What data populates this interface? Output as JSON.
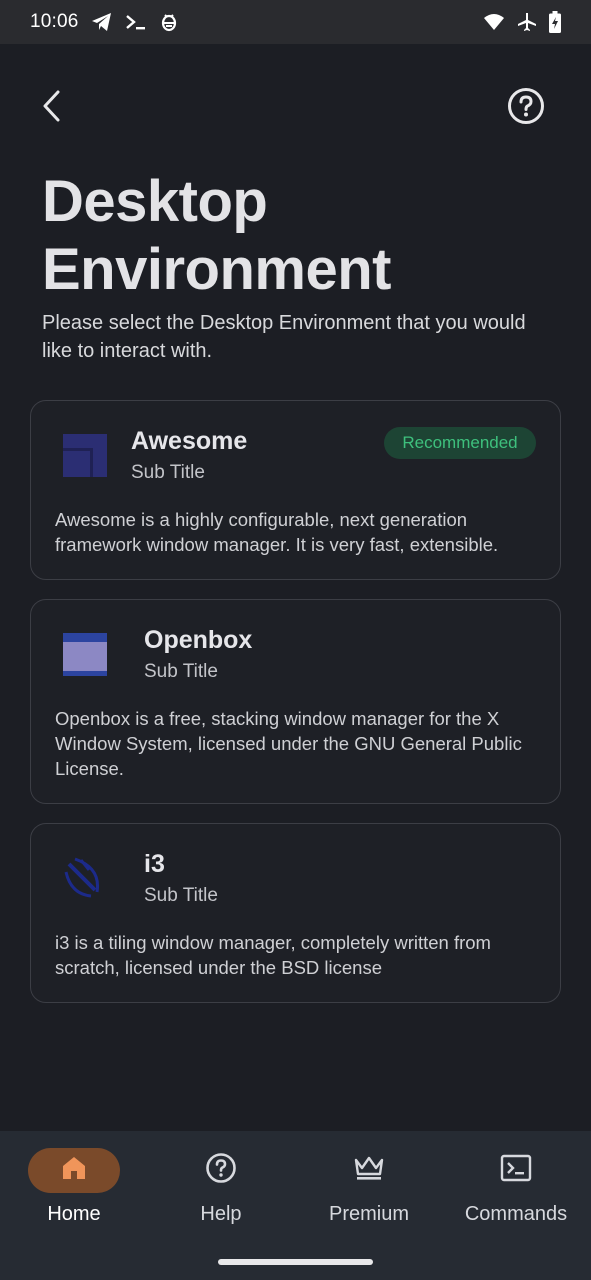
{
  "status_bar": {
    "time": "10:06",
    "left_icons": [
      "telegram-icon",
      "terminal-prompt-icon",
      "bug-icon"
    ],
    "right_icons": [
      "wifi-icon",
      "airplane-icon",
      "battery-charging-icon"
    ]
  },
  "header": {
    "back_icon": "chevron-left-icon",
    "help_icon": "help-circle-icon",
    "title": "Desktop Environment",
    "subtitle": "Please select the Desktop Environment that you would like to interact with."
  },
  "environments": [
    {
      "name": "Awesome",
      "sub_title": "Sub Title",
      "badge": "Recommended",
      "description": "Awesome is a highly configurable, next generation framework window manager. It is very fast, extensible.",
      "icon": "awesome-logo-icon"
    },
    {
      "name": "Openbox",
      "sub_title": "Sub Title",
      "description": "Openbox is a free, stacking window manager for the X Window System, licensed under the GNU General Public License.",
      "icon": "openbox-logo-icon"
    },
    {
      "name": "i3",
      "sub_title": "Sub Title",
      "description": "i3 is a tiling window manager, completely written from scratch, licensed under the BSD license",
      "icon": "i3-logo-icon"
    }
  ],
  "bottom_nav": {
    "active": "Home",
    "items": [
      {
        "label": "Home",
        "icon": "home-icon"
      },
      {
        "label": "Help",
        "icon": "help-circle-icon"
      },
      {
        "label": "Premium",
        "icon": "crown-icon"
      },
      {
        "label": "Commands",
        "icon": "terminal-icon"
      }
    ]
  },
  "colors": {
    "background": "#1c1e24",
    "status_bar": "#2a2b2f",
    "bottom_nav": "#262b33",
    "active_pill": "#7a4a2a",
    "active_icon": "#f0955a",
    "badge_bg": "#1d4434",
    "badge_text": "#3ec07d",
    "card_border": "#3c3e45"
  }
}
